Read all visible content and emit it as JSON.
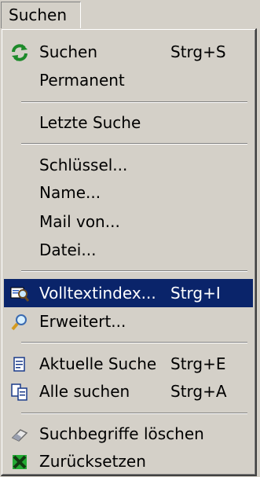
{
  "menubar": {
    "menu_title": "Suchen"
  },
  "menu": {
    "items": [
      {
        "label": "Suchen",
        "shortcut": "Strg+S",
        "icon": "refresh-icon"
      },
      {
        "label": "Permanent"
      },
      {
        "label": "Letzte Suche"
      },
      {
        "label": "Schlüssel..."
      },
      {
        "label": "Name..."
      },
      {
        "label": "Mail von..."
      },
      {
        "label": "Datei..."
      },
      {
        "label": "Volltextindex...",
        "shortcut": "Strg+I",
        "icon": "fulltext-index-icon",
        "highlighted": true
      },
      {
        "label": "Erweitert...",
        "icon": "magnifier-icon"
      },
      {
        "label": "Aktuelle Suche",
        "shortcut": "Strg+E",
        "icon": "document-icon"
      },
      {
        "label": "Alle suchen",
        "shortcut": "Strg+A",
        "icon": "documents-icon"
      },
      {
        "label": "Suchbegriffe löschen",
        "icon": "eraser-icon"
      },
      {
        "label": "Zurücksetzen",
        "icon": "reset-icon"
      }
    ]
  },
  "colors": {
    "menu_bg": "#d4d0c8",
    "highlight": "#0a246a",
    "highlight_text": "#ffffff"
  }
}
